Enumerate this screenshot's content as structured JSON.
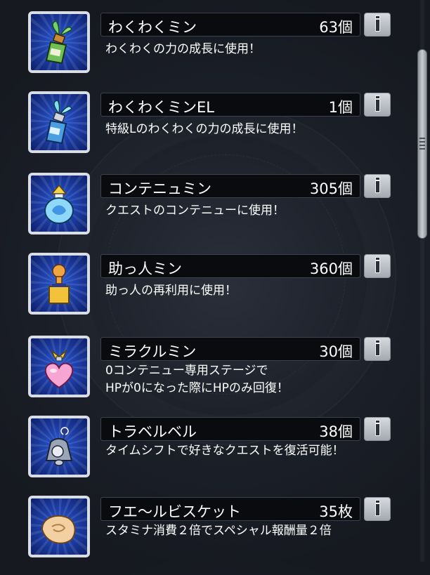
{
  "items": [
    {
      "name": "わくわくミン",
      "count": "63個",
      "desc": [
        "わくわくの力の成長に使用！"
      ],
      "icon": "green-sprout-bottle-icon"
    },
    {
      "name": "わくわくミンEL",
      "count": "1個",
      "desc": [
        "特級Lのわくわくの力の成長に使用！"
      ],
      "icon": "blue-el-bottle-icon"
    },
    {
      "name": "コンテニュミン",
      "count": "305個",
      "desc": [
        "クエストのコンテニューに使用！"
      ],
      "icon": "continue-potion-icon"
    },
    {
      "name": "助っ人ミン",
      "count": "360個",
      "desc": [
        "助っ人の再利用に使用！"
      ],
      "icon": "helper-bottle-icon"
    },
    {
      "name": "ミラクルミン",
      "count": "30個",
      "desc": [
        "0コンテニュー専用ステージで",
        "HPが0になった際にHPのみ回復！"
      ],
      "icon": "heart-potion-icon"
    },
    {
      "name": "トラベルベル",
      "count": "38個",
      "desc": [
        "タイムシフトで好きなクエストを復活可能！"
      ],
      "icon": "travel-bell-icon"
    },
    {
      "name": "フエ～ルビスケット",
      "count": "35枚",
      "desc": [
        "スタミナ消費２倍でスペシャル報酬量２倍"
      ],
      "icon": "biscuit-icon"
    }
  ],
  "colors": {
    "background": "#1c2029",
    "name_bar": "#0a0b0e",
    "thumb_blue": "#1e3fa8",
    "info_button": "#c4c8ce"
  }
}
